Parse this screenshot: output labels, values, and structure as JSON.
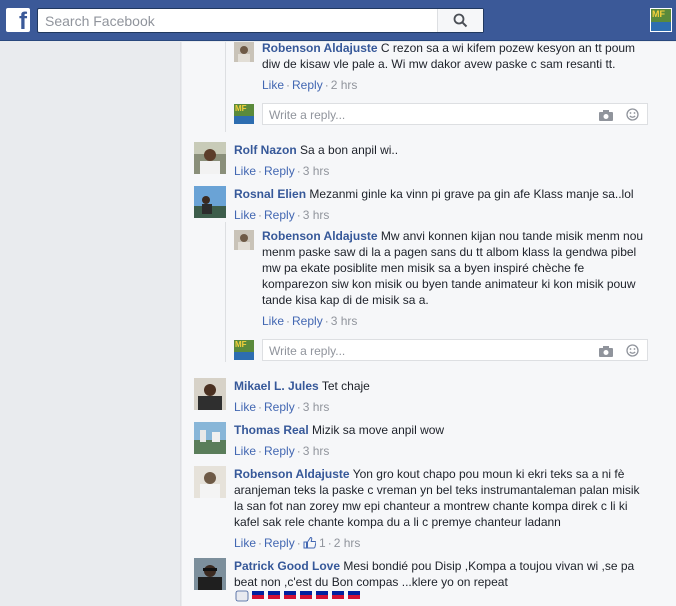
{
  "search": {
    "placeholder": "Search Facebook"
  },
  "topbar": {
    "avatar_text": "MF\nKIZINE"
  },
  "actions": {
    "like": "Like",
    "reply": "Reply"
  },
  "reply_box": {
    "placeholder": "Write a reply..."
  },
  "comments": [
    {
      "name": "Robenson Aldajuste",
      "text": "C rezon sa a wi kifem pozew kesyon an tt poum diw de kisaw vle pale a. Wi mw dakor avew paske c sam resanti tt.",
      "time": "2 hrs"
    },
    {
      "name": "Rolf Nazon",
      "text": "Sa a bon anpil wi..",
      "time": "3 hrs"
    },
    {
      "name": "Rosnal Elien",
      "text": "Mezanmi ginle ka vinn pi grave pa gin afe Klass manje sa..lol",
      "time": "3 hrs"
    },
    {
      "name": "Robenson Aldajuste",
      "text": "Mw anvi konnen kijan nou tande misik menm nou menm paske saw di la a pagen sans du tt albom klass la gendwa pibel mw pa ekate posiblite men misik sa a byen inspiré chèche fe komparezon siw kon misik ou byen tande animateur ki kon misik pouw tande kisa kap di de misik sa a.",
      "time": "3 hrs"
    },
    {
      "name": "Mikael L. Jules",
      "text": "Tet chaje",
      "time": "3 hrs"
    },
    {
      "name": "Thomas Real",
      "text": "Mizik sa move anpil wow",
      "time": "3 hrs"
    },
    {
      "name": "Robenson Aldajuste",
      "text": "Yon gro kout chapo pou moun ki ekri teks sa a ni fè aranjeman teks la paske c vreman yn bel teks instrumantaleman palan misik la san fot nan zorey mw epi chanteur a montrew chante kompa direk c li ki kafel sak rele chante kompa du a li c premye chanteur ladann",
      "time": "2 hrs",
      "likes": "1"
    },
    {
      "name": "Patrick Good Love",
      "text": "Mesi bondié pou Disip ,Kompa a toujou vivan wi ,se pa beat non ,c'est du Bon compas ...klere yo on repeat",
      "time": ""
    }
  ],
  "colors": {
    "facebook_blue": "#3b5998",
    "link_blue": "#4267b2",
    "name_blue": "#365899"
  }
}
